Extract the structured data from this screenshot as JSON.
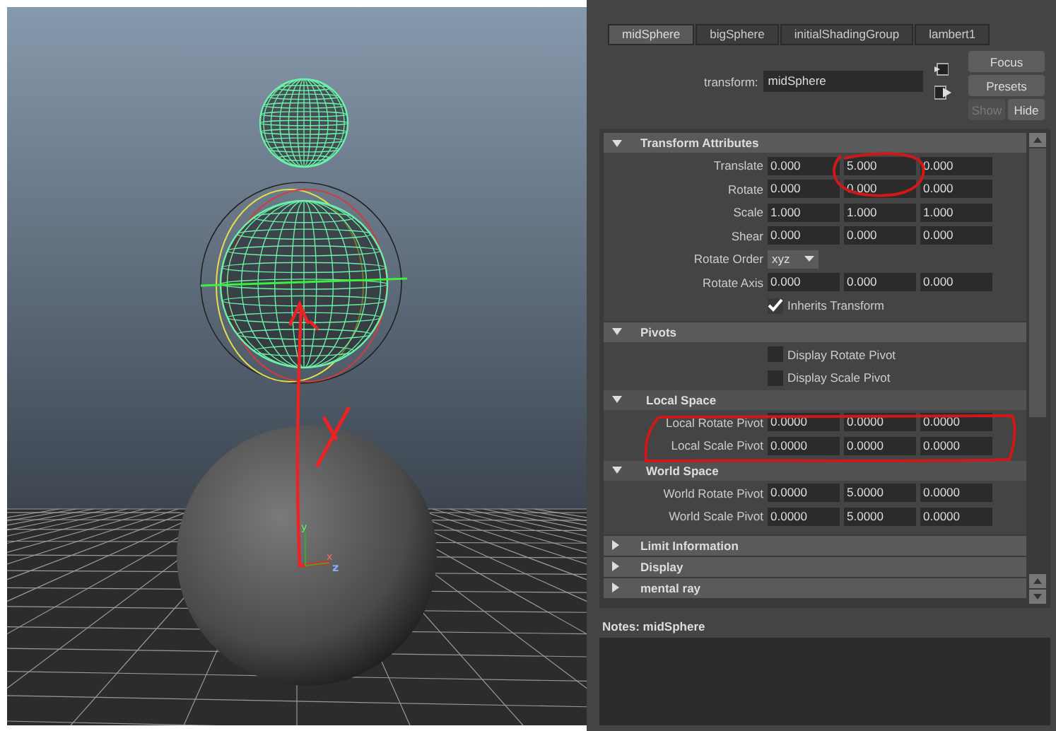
{
  "viewport": {
    "axis_labels": [
      "y",
      "x",
      "z"
    ]
  },
  "tabs": [
    {
      "label": "midSphere",
      "selected": true
    },
    {
      "label": "bigSphere",
      "selected": false
    },
    {
      "label": "initialShadingGroup",
      "selected": false
    },
    {
      "label": "lambert1",
      "selected": false
    }
  ],
  "node": {
    "label": "transform:",
    "value": "midSphere"
  },
  "buttons": [
    {
      "label": "Focus",
      "disabled": false
    },
    {
      "label": "Presets",
      "disabled": false
    },
    {
      "label": "Show",
      "disabled": true
    },
    {
      "label": "Hide",
      "disabled": false
    }
  ],
  "sections": [
    {
      "title": "Transform Attributes",
      "expanded": true,
      "rows": [
        {
          "kind": "vector",
          "label": "Translate",
          "values": [
            "0.000",
            "5.000",
            "0.000"
          ]
        },
        {
          "kind": "vector",
          "label": "Rotate",
          "values": [
            "0.000",
            "0.000",
            "0.000"
          ]
        },
        {
          "kind": "vector",
          "label": "Scale",
          "values": [
            "1.000",
            "1.000",
            "1.000"
          ]
        },
        {
          "kind": "vector",
          "label": "Shear",
          "values": [
            "0.000",
            "0.000",
            "0.000"
          ]
        },
        {
          "kind": "dropdown",
          "label": "Rotate Order",
          "value": "xyz"
        },
        {
          "kind": "vector",
          "label": "Rotate Axis",
          "values": [
            "0.000",
            "0.000",
            "0.000"
          ]
        },
        {
          "kind": "checkbox",
          "label": "Inherits Transform",
          "checked": true
        }
      ]
    },
    {
      "title": "Pivots",
      "expanded": true,
      "rows": [
        {
          "kind": "checkbox",
          "label": "Display Rotate Pivot",
          "checked": false
        },
        {
          "kind": "checkbox",
          "label": "Display Scale Pivot",
          "checked": false
        }
      ],
      "children": [
        {
          "title": "Local Space",
          "expanded": true,
          "rows": [
            {
              "kind": "vector",
              "label": "Local Rotate Pivot",
              "values": [
                "0.0000",
                "0.0000",
                "0.0000"
              ]
            },
            {
              "kind": "vector",
              "label": "Local Scale Pivot",
              "values": [
                "0.0000",
                "0.0000",
                "0.0000"
              ]
            }
          ]
        },
        {
          "title": "World Space",
          "expanded": true,
          "rows": [
            {
              "kind": "vector",
              "label": "World Rotate Pivot",
              "values": [
                "0.0000",
                "5.0000",
                "0.0000"
              ]
            },
            {
              "kind": "vector",
              "label": "World Scale Pivot",
              "values": [
                "0.0000",
                "5.0000",
                "0.0000"
              ]
            }
          ]
        }
      ]
    },
    {
      "title": "Limit Information",
      "expanded": false
    },
    {
      "title": "Display",
      "expanded": false
    },
    {
      "title": "mental ray",
      "expanded": false
    }
  ],
  "notes": {
    "label": "Notes:  midSphere"
  }
}
